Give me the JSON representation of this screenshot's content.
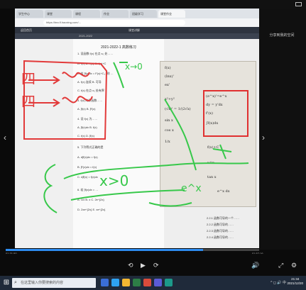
{
  "player": {
    "right_label": "分享到我的空间",
    "prev_arrow": "‹",
    "next_arrow": "›",
    "time_current": "01:31:50",
    "time_total": "01:57:16",
    "progress": 0.78,
    "controls": {
      "rewind": "⟲",
      "play": "▶",
      "forward": "⟳",
      "volume": "🔊",
      "fullscreen": "⤢",
      "settings": "⚙"
    }
  },
  "browser": {
    "tabs": [
      "学生中心",
      "课堂",
      "课程",
      "作业",
      "班级学习",
      "课堂作业"
    ],
    "url": "https://tea.fl.haoxing.com/...",
    "app_title_left": "返回首页",
    "app_title_center": "课堂讲解",
    "year_badge": "2021-2022"
  },
  "document": {
    "title": "2021-2022-1 高数练习",
    "questions": [
      "1. 设函数 f(x) 在点 x₀ 处……",
      "A. f(x)    B. f'(x)    C. f(x)+C",
      "2. 若 ∫f(x)dx = F(x)+C，则 …",
      "A. f(x) 连续  B. 可导",
      "C. f(x) 在点 x₀ 处有界",
      "3. f(x) 的原函数……",
      "A. ∫f(x)    B. ∫f'(x)",
      "4. 设 f(x) 为……",
      "A. ∫f(x)dx    B. f(x)",
      "C. f(x)    D. ∫f(x)",
      "5. 下列等式正确的是",
      "A. d∫f(x)dx = f(x)",
      "B. ∫f'(x)dx = f(x)",
      "C. d∫f(x) = f(x)dx",
      "6. 若 ∫f(x)dx = …",
      "A. 1/x    B. x    C. 2e^{2x}",
      "D. 2xe^{2x}    E. xe^{2x}"
    ]
  },
  "photo": {
    "lines": [
      "f(x)",
      "(lnx)'",
      "ex'",
      "(e^x)'=e^x",
      "dy = y'dx",
      "f'(x)",
      "∫f(x)dx",
      "x²+y²",
      "(√x)' = 1/(2√x)",
      "sin x",
      "cos x",
      "1/x",
      "f(x)+C",
      "x^n",
      "tan x",
      "e^x dx"
    ]
  },
  "side_list": [
    "2.2.1 函数可导的一个……",
    "2.2.2 函数可导的……",
    "2.2.3 函数可导的……",
    "2.2.4 函数可导的……"
  ],
  "overlay": {
    "red_color": "#e23a3a",
    "green_color": "#37c84a",
    "green_text_1": "x→0",
    "green_text_2": "x>0",
    "green_text_3": "e^x",
    "red_text": "四"
  },
  "taskbar": {
    "start_icon": "⊞",
    "search_placeholder": "在这里输入你要搜索的内容",
    "search_icon": "⌕",
    "clock_time": "21:34",
    "clock_date": "2021/12/20",
    "tray": "^ ◻ 🔊 中"
  }
}
